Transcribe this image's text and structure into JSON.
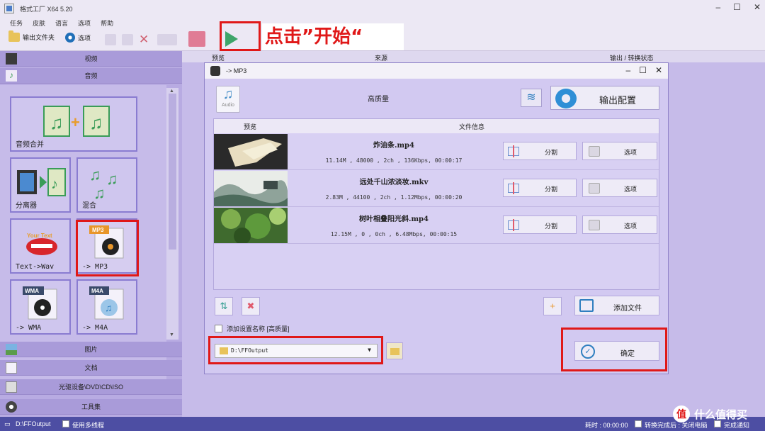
{
  "window": {
    "title": "格式工厂 X64 5.20"
  },
  "menu": [
    "任务",
    "皮肤",
    "语言",
    "选项",
    "帮助"
  ],
  "toolbar": {
    "output_folder": "输出文件夹",
    "options": "选项"
  },
  "annotation": {
    "text": "点击”开始“"
  },
  "list_header": {
    "preview": "预览",
    "source": "来源",
    "status": "输出 / 转换状态"
  },
  "left_panel": {
    "categories": {
      "video": "视频",
      "audio": "音频",
      "image": "图片",
      "document": "文档",
      "disc": "光驱设备\\DVD\\CD\\ISO",
      "toolbox": "工具集"
    },
    "tiles": [
      {
        "label": "音频合并",
        "icon": "audio-merge-icon"
      },
      {
        "label": "分离器",
        "icon": "splitter-icon"
      },
      {
        "label": "混合",
        "icon": "mix-icon"
      },
      {
        "label": "Text->Wav",
        "icon": "text-to-wav-icon",
        "badge": "Your Text"
      },
      {
        "label": "-> MP3",
        "icon": "mp3-icon",
        "badge": "MP3"
      },
      {
        "label": "-> WMA",
        "icon": "wma-icon",
        "badge": "WMA"
      },
      {
        "label": "-> M4A",
        "icon": "m4a-icon",
        "badge": "M4A"
      }
    ]
  },
  "dialog": {
    "title": "-> MP3",
    "quality": "高质量",
    "audio_icon_label": "Audio",
    "output_config": "输出配置",
    "table_headers": {
      "preview": "预览",
      "fileinfo": "文件信息"
    },
    "files": [
      {
        "name": "炸油条.mp4",
        "info": "11.14M , 48000 , 2ch , 136Kbps, 00:00:17",
        "split": "分割",
        "options": "选项"
      },
      {
        "name": "远处千山浓淡妆.mkv",
        "info": "2.83M , 44100 , 2ch , 1.12Mbps, 00:00:20",
        "split": "分割",
        "options": "选项"
      },
      {
        "name": "树叶相叠阳光斜.mp4",
        "info": "12.15M , 0 , 0ch , 6.48Mbps, 00:00:15",
        "split": "分割",
        "options": "选项"
      }
    ],
    "add_file": "添加文件",
    "add_setting_name": "添加设置名称 [高质量]",
    "output_path": "D:\\FFOutput",
    "ok": "确定"
  },
  "statusbar": {
    "path": "D:\\FFOutput",
    "multithread": "使用多线程",
    "elapsed": "耗时 : 00:00:00",
    "after_convert": "转换完成后 : 关闭电脑",
    "notify": "完成通知"
  },
  "watermark": {
    "text": "什么值得买",
    "icon": "值"
  },
  "colors": {
    "accent": "#2f7fc0",
    "annotation_red": "#e01818",
    "panel": "#b8abe2",
    "status": "#4d4ea3"
  }
}
